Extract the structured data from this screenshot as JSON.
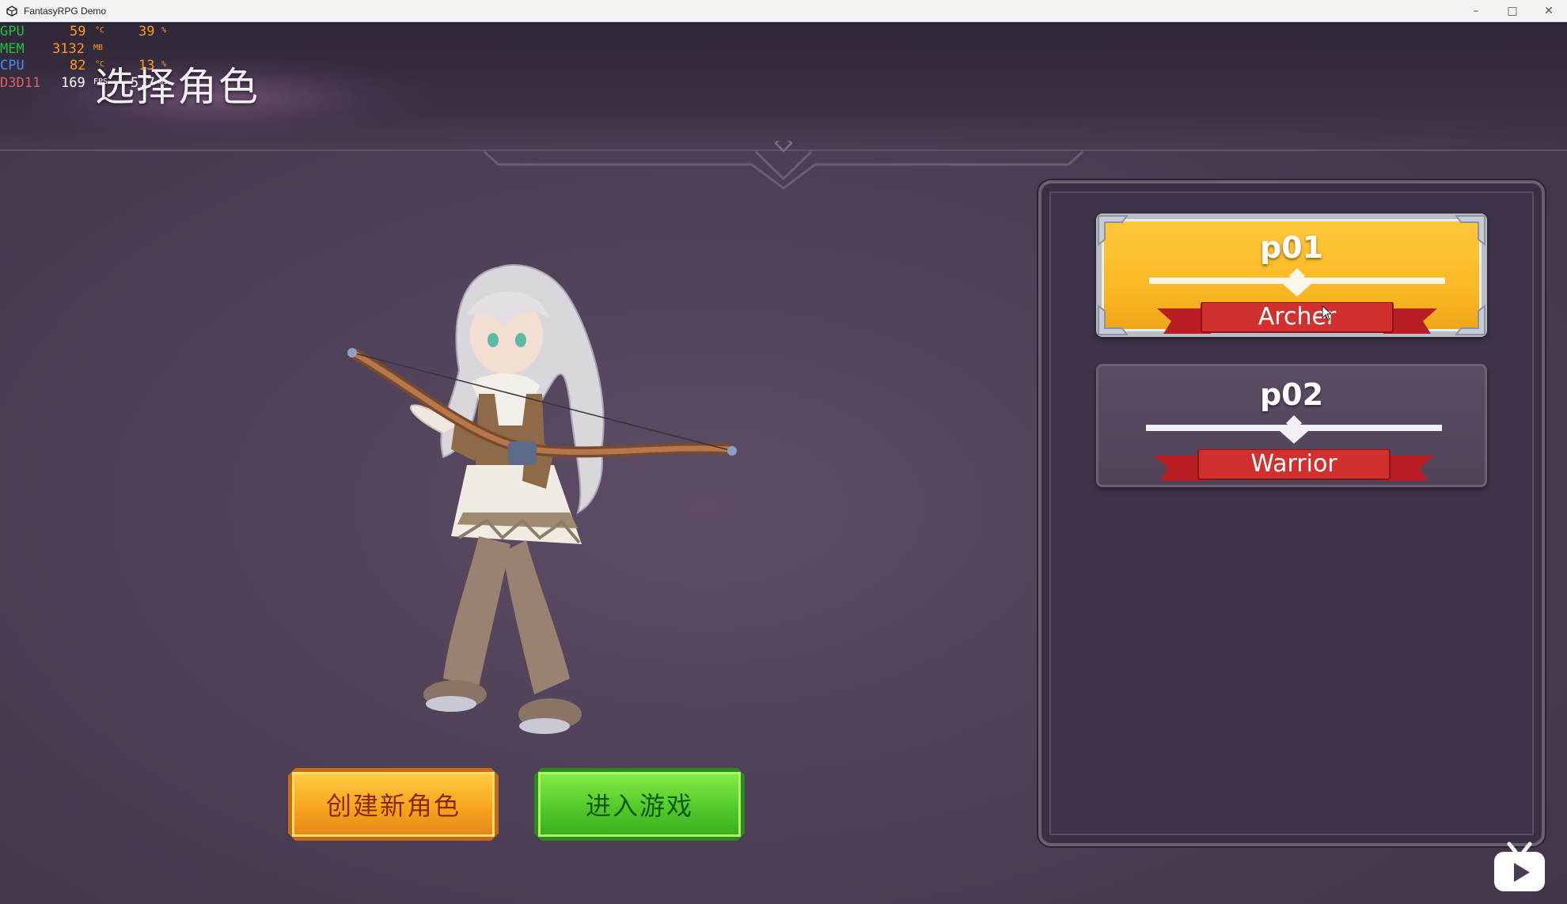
{
  "window": {
    "title": "FantasyRPG Demo",
    "minimize_glyph": "–",
    "maximize_glyph": "□",
    "close_glyph": "✕"
  },
  "hud": {
    "gpu_label": "GPU",
    "gpu_temp": "59",
    "gpu_temp_unit": "°C",
    "gpu_load": "39",
    "gpu_load_unit": "%",
    "mem_label": "MEM",
    "mem_value": "3132",
    "mem_unit": "MB",
    "cpu_label": "CPU",
    "cpu_temp": "82",
    "cpu_temp_unit": "°C",
    "cpu_load": "13",
    "cpu_load_unit": "%",
    "api_label": "D3D11",
    "fps_value": "169",
    "fps_unit": "FPS",
    "frametime_value": "5.7",
    "frametime_unit": "ms"
  },
  "page": {
    "title": "选择角色"
  },
  "buttons": {
    "create_label": "创建新角色",
    "enter_label": "进入游戏"
  },
  "characters": [
    {
      "name": "p01",
      "class": "Archer",
      "selected": true
    },
    {
      "name": "p02",
      "class": "Warrior",
      "selected": false
    }
  ],
  "colors": {
    "background": "#4a3d52",
    "card_selected": "#fbb924",
    "card_normal": "#554760",
    "ribbon": "#c8282a",
    "create_button": "#f6a51c",
    "enter_button": "#52c92a"
  },
  "icons": {
    "app": "unity-icon",
    "watermark": "bilibili-tv-icon"
  }
}
